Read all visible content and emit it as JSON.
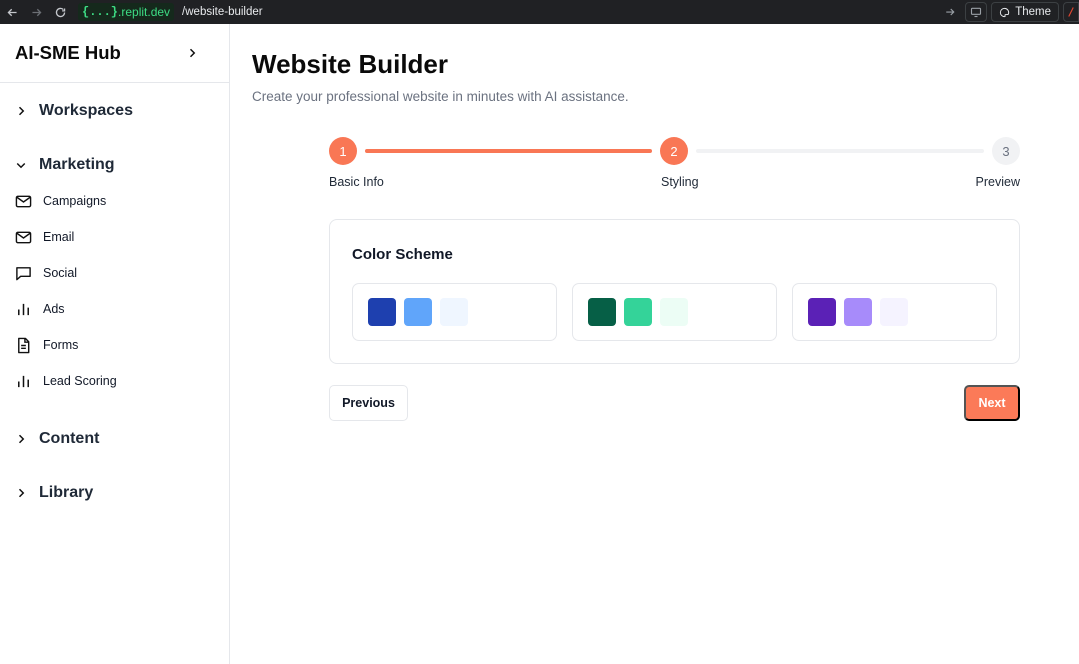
{
  "browser": {
    "url_brace": "{...}",
    "url_host": ".replit.dev",
    "url_path": "/website-builder",
    "theme_label": "Theme"
  },
  "sidebar": {
    "brand": "AI-SME Hub",
    "sections": [
      {
        "label": "Workspaces",
        "expanded": false
      },
      {
        "label": "Marketing",
        "expanded": true,
        "items": [
          {
            "label": "Campaigns",
            "icon": "mail-icon"
          },
          {
            "label": "Email",
            "icon": "mail-icon"
          },
          {
            "label": "Social",
            "icon": "message-square-icon"
          },
          {
            "label": "Ads",
            "icon": "bar-chart-icon"
          },
          {
            "label": "Forms",
            "icon": "file-text-icon"
          },
          {
            "label": "Lead Scoring",
            "icon": "bar-chart-icon"
          }
        ]
      },
      {
        "label": "Content",
        "expanded": false
      },
      {
        "label": "Library",
        "expanded": false
      }
    ]
  },
  "main": {
    "title": "Website Builder",
    "subtitle": "Create your professional website in minutes with AI assistance.",
    "steps": [
      {
        "number": "1",
        "label": "Basic Info",
        "state": "done"
      },
      {
        "number": "2",
        "label": "Styling",
        "state": "current"
      },
      {
        "number": "3",
        "label": "Preview",
        "state": "todo"
      }
    ],
    "color_scheme": {
      "title": "Color Scheme",
      "options": [
        {
          "colors": [
            "#1e40af",
            "#60a5fa",
            "#eff6ff"
          ]
        },
        {
          "colors": [
            "#065f46",
            "#34d399",
            "#ecfdf5"
          ]
        },
        {
          "colors": [
            "#5b21b6",
            "#a78bfa",
            "#f5f3ff"
          ]
        }
      ]
    },
    "previous_label": "Previous",
    "next_label": "Next"
  },
  "colors": {
    "accent": "#f97755",
    "border": "#e5e7eb"
  }
}
